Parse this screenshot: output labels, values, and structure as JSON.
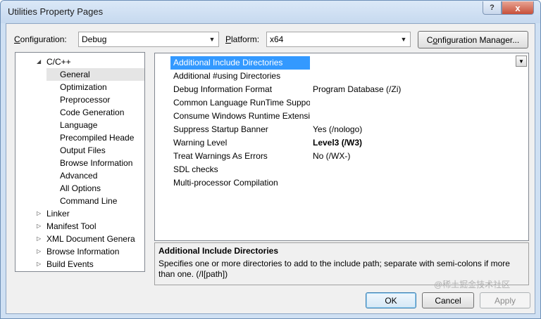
{
  "window": {
    "title": "Utilities Property Pages"
  },
  "titlebar": {
    "help_glyph": "?",
    "close_glyph": "x"
  },
  "configuration": {
    "label_prefix": "",
    "label_mnemonic": "C",
    "label_rest": "onfiguration:",
    "value": "Debug"
  },
  "platform": {
    "label_mnemonic": "P",
    "label_rest": "latform:",
    "value": "x64"
  },
  "config_manager": {
    "label_prefix": "C",
    "label_mnemonic": "o",
    "label_rest": "nfiguration Manager..."
  },
  "tree": {
    "items": [
      {
        "label": "C/C++",
        "expander": "◢",
        "indent": 0,
        "selected": false
      },
      {
        "label": "General",
        "expander": "",
        "indent": 1,
        "selected": true
      },
      {
        "label": "Optimization",
        "expander": "",
        "indent": 1,
        "selected": false
      },
      {
        "label": "Preprocessor",
        "expander": "",
        "indent": 1,
        "selected": false
      },
      {
        "label": "Code Generation",
        "expander": "",
        "indent": 1,
        "selected": false
      },
      {
        "label": "Language",
        "expander": "",
        "indent": 1,
        "selected": false
      },
      {
        "label": "Precompiled Heade",
        "expander": "",
        "indent": 1,
        "selected": false
      },
      {
        "label": "Output Files",
        "expander": "",
        "indent": 1,
        "selected": false
      },
      {
        "label": "Browse Information",
        "expander": "",
        "indent": 1,
        "selected": false
      },
      {
        "label": "Advanced",
        "expander": "",
        "indent": 1,
        "selected": false
      },
      {
        "label": "All Options",
        "expander": "",
        "indent": 1,
        "selected": false
      },
      {
        "label": "Command Line",
        "expander": "",
        "indent": 1,
        "selected": false
      },
      {
        "label": "Linker",
        "expander": "▷",
        "indent": 0,
        "selected": false
      },
      {
        "label": "Manifest Tool",
        "expander": "▷",
        "indent": 0,
        "selected": false
      },
      {
        "label": "XML Document Genera",
        "expander": "▷",
        "indent": 0,
        "selected": false
      },
      {
        "label": "Browse Information",
        "expander": "▷",
        "indent": 0,
        "selected": false
      },
      {
        "label": "Build Events",
        "expander": "▷",
        "indent": 0,
        "selected": false
      }
    ]
  },
  "properties": {
    "rows": [
      {
        "name": "Additional Include Directories",
        "value": "",
        "bold": false,
        "selected": true
      },
      {
        "name": "Additional #using Directories",
        "value": "",
        "bold": false,
        "selected": false
      },
      {
        "name": "Debug Information Format",
        "value": "Program Database (/Zi)",
        "bold": false,
        "selected": false
      },
      {
        "name": "Common Language RunTime Suppo",
        "value": "",
        "bold": false,
        "selected": false
      },
      {
        "name": "Consume Windows Runtime Extensic",
        "value": "",
        "bold": false,
        "selected": false
      },
      {
        "name": "Suppress Startup Banner",
        "value": "Yes (/nologo)",
        "bold": false,
        "selected": false
      },
      {
        "name": "Warning Level",
        "value": "Level3 (/W3)",
        "bold": true,
        "selected": false
      },
      {
        "name": "Treat Warnings As Errors",
        "value": "No (/WX-)",
        "bold": false,
        "selected": false
      },
      {
        "name": "SDL checks",
        "value": "",
        "bold": false,
        "selected": false
      },
      {
        "name": "Multi-processor Compilation",
        "value": "",
        "bold": false,
        "selected": false
      }
    ]
  },
  "description": {
    "title": "Additional Include Directories",
    "body": "Specifies one or more directories to add to the include path; separate with semi-colons if more than one.    (/I[path])"
  },
  "buttons": {
    "ok": "OK",
    "cancel": "Cancel",
    "apply": "Apply"
  },
  "watermark": "@稀土掘金技术社区"
}
